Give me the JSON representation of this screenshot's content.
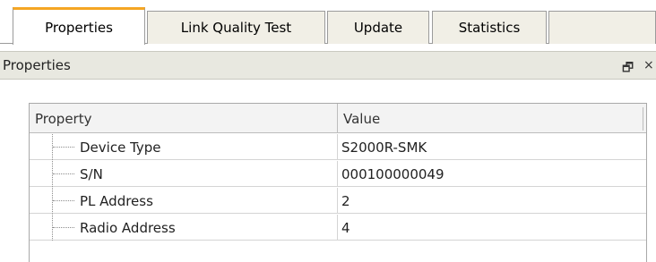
{
  "tabs": [
    {
      "label": "Properties",
      "active": true
    },
    {
      "label": "Link Quality Test",
      "active": false
    },
    {
      "label": "Update",
      "active": false
    },
    {
      "label": "Statistics",
      "active": false
    }
  ],
  "panel": {
    "title": "Properties",
    "icons": [
      "restore-icon",
      "close-icon"
    ],
    "restore_glyph": "🗗",
    "close_glyph": "×"
  },
  "grid": {
    "columns": [
      "Property",
      "Value"
    ],
    "rows": [
      {
        "name": "Device Type",
        "value": "S2000R-SMK"
      },
      {
        "name": "S/N",
        "value": "000100000049"
      },
      {
        "name": "PL Address",
        "value": "2"
      },
      {
        "name": "Radio Address",
        "value": "4"
      }
    ]
  },
  "colors": {
    "active_tab_accent": "#f5a623",
    "tab_background": "#f1efe6",
    "panel_header_background": "#e8e8e0"
  }
}
